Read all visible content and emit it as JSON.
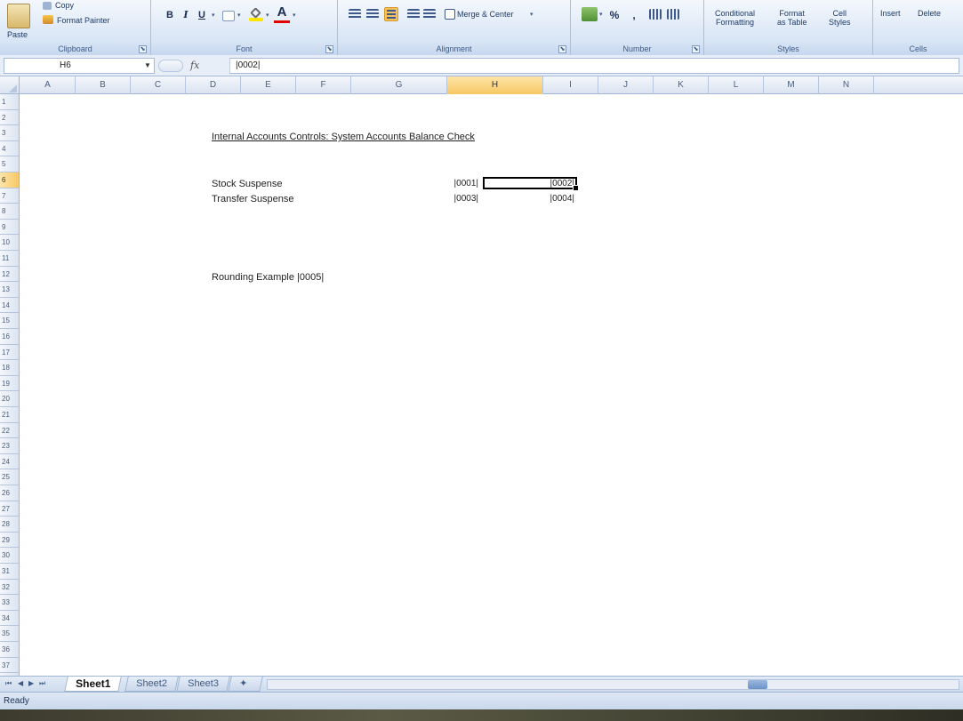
{
  "ribbon": {
    "clipboard": {
      "paste": "Paste",
      "copy": "Copy",
      "format_painter": "Format Painter",
      "label": "Clipboard"
    },
    "font": {
      "bold": "B",
      "italic": "I",
      "underline": "U",
      "font_color": "A",
      "label": "Font"
    },
    "alignment": {
      "merge_center": "Merge & Center",
      "label": "Alignment"
    },
    "number": {
      "percent": "%",
      "comma": ",",
      "label": "Number"
    },
    "styles": {
      "conditional": "Conditional\nFormatting",
      "format_table": "Format\nas Table",
      "cell_styles": "Cell\nStyles",
      "label": "Styles"
    },
    "cells": {
      "insert": "Insert",
      "delete": "Delete",
      "label": "Cells"
    },
    "launcher_glyph": "⬊"
  },
  "formula_bar": {
    "name_box": "H6",
    "fx": "fx",
    "formula": "|0002|"
  },
  "columns": [
    "A",
    "B",
    "C",
    "D",
    "E",
    "F",
    "G",
    "H",
    "I",
    "J",
    "K",
    "L",
    "M",
    "N"
  ],
  "selected_column": "H",
  "rows": [
    "1",
    "2",
    "3",
    "4",
    "5",
    "6",
    "7",
    "8",
    "9",
    "10",
    "11",
    "12",
    "13",
    "14",
    "15",
    "16",
    "17",
    "18",
    "19",
    "20",
    "21",
    "22",
    "23",
    "24",
    "25",
    "26",
    "27",
    "28",
    "29",
    "30",
    "31",
    "32",
    "33",
    "34",
    "35",
    "36",
    "37"
  ],
  "selected_row": "6",
  "cells": {
    "title": "Internal Accounts Controls: System Accounts Balance Check",
    "row6_label": "Stock Suspense",
    "row6_g": "|0001|",
    "row6_h": "|0002|",
    "row7_label": "Transfer Suspense",
    "row7_g": "|0003|",
    "row7_h": "|0004|",
    "row12_label": "Rounding Example |0005|"
  },
  "sheets": {
    "tabs": [
      "Sheet1",
      "Sheet2",
      "Sheet3"
    ],
    "active": "Sheet1",
    "nav": [
      "⏮",
      "◀",
      "▶",
      "⏭"
    ]
  },
  "status": {
    "text": "Ready"
  },
  "colors": {
    "ribbon_bg": "#dde8f6",
    "selection_header": "#f7c763",
    "grid_header": "#dbe4f1"
  }
}
